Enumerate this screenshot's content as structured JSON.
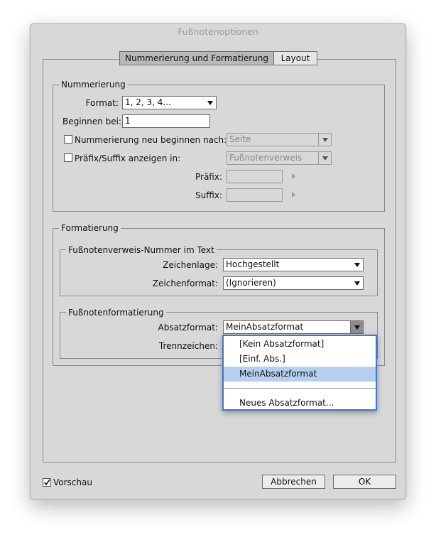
{
  "window": {
    "title": "Fußnotenoptionen"
  },
  "tabs": [
    {
      "label": "Nummerierung und Formatierung",
      "active": true
    },
    {
      "label": "Layout",
      "active": false
    }
  ],
  "nummerierung": {
    "legend": "Nummerierung",
    "format_label": "Format:",
    "format_value": "1, 2, 3, 4...",
    "beginnen_label": "Beginnen bei:",
    "beginnen_value": "1",
    "neu_beginnen_label": "Nummerierung neu beginnen nach:",
    "neu_beginnen_checked": false,
    "neu_beginnen_value": "Seite",
    "praefix_suffix_label": "Präfix/Suffix anzeigen in:",
    "praefix_suffix_checked": false,
    "praefix_suffix_value": "Fußnotenverweis",
    "praefix_label": "Präfix:",
    "praefix_value": "",
    "suffix_label": "Suffix:",
    "suffix_value": ""
  },
  "formatierung": {
    "legend": "Formatierung",
    "verweis_group": {
      "legend": "Fußnotenverweis-Nummer im Text",
      "zeichenlage_label": "Zeichenlage:",
      "zeichenlage_value": "Hochgestellt",
      "zeichenformat_label": "Zeichenformat:",
      "zeichenformat_value": "(Ignorieren)"
    },
    "fussnoten_group": {
      "legend": "Fußnotenformatierung",
      "absatzformat_label": "Absatzformat:",
      "absatzformat_value": "MeinAbsatzformat",
      "trennzeichen_label": "Trennzeichen:"
    }
  },
  "absatzformat_menu": {
    "items": [
      "[Kein Absatzformat]",
      "[Einf. Abs.]",
      "MeinAbsatzformat",
      "",
      "Neues Absatzformat..."
    ],
    "selected_index": 2
  },
  "footer": {
    "vorschau_label": "Vorschau",
    "vorschau_checked": true,
    "abbrechen_label": "Abbrechen",
    "ok_label": "OK"
  },
  "colors": {
    "dialog_bg": "#d8d8d8",
    "selection": "#b4cff0",
    "menu_border": "#3f78c8",
    "active_tab": "#b9b9b9"
  },
  "icons": [
    "dropdown-arrow-icon",
    "checkmark-icon",
    "stepper-arrow-icon"
  ]
}
